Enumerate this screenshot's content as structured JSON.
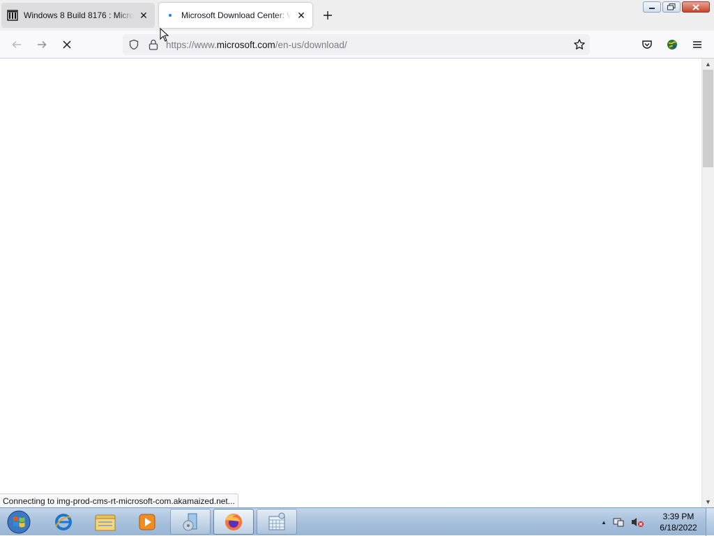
{
  "tabs": [
    {
      "title": "Windows 8 Build 8176 : Micros",
      "favicon": "archive-icon",
      "active": false
    },
    {
      "title": "Microsoft Download Center: Wi",
      "favicon": "loading-dot-icon",
      "active": true
    }
  ],
  "toolbar": {
    "url_prefix": "https://www.",
    "url_host": "microsoft.com",
    "url_path": "/en-us/download/",
    "back": "back-icon",
    "forward": "forward-icon",
    "stop": "stop-icon"
  },
  "status_text": "Connecting to img-prod-cms-rt-microsoft-com.akamaized.net...",
  "taskbar": {
    "apps": [
      "internet-explorer-icon",
      "file-explorer-icon",
      "media-player-icon",
      "setup-disc-icon",
      "firefox-icon",
      "calendar-icon"
    ],
    "clock_time": "3:39 PM",
    "clock_date": "6/18/2022"
  },
  "colors": {
    "accent": "#0a84ff",
    "taskbar": "#a9c2dd"
  }
}
